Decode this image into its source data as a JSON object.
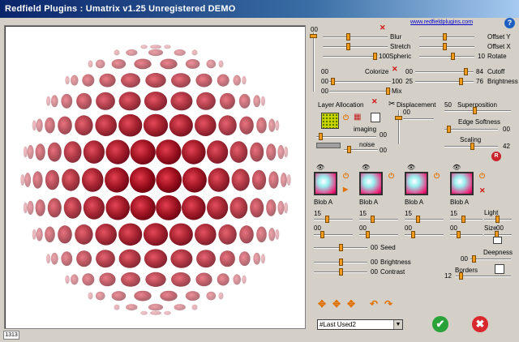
{
  "title": "Redfield Plugins : Umatrix v1.25     Unregistered  DEMO",
  "url": "www.redfieldplugins.com",
  "help_glyph": "?",
  "status": "1313",
  "sliders": {
    "left_vert_val": "00",
    "blur": {
      "label": "Blur"
    },
    "stretch": {
      "label": "Stretch"
    },
    "sphere": {
      "value": "100",
      "label": "Spheric"
    },
    "offset_y": {
      "label": "Offset Y"
    },
    "offset_x": {
      "label": "Offset X"
    },
    "rotate": {
      "value": "10",
      "label": "Rotate"
    },
    "colorize": {
      "label": "Colorize",
      "v1": "00",
      "v2": "00",
      "v3": "00",
      "v4": "100"
    },
    "mix": {
      "label": "Mix"
    },
    "cutoff": {
      "value": "84",
      "label": "Cutoff",
      "pre": "00"
    },
    "brightness_top": {
      "value": "76",
      "label": "Brightness",
      "pre": "25"
    }
  },
  "layer": {
    "label": "Layer Allocation",
    "imaging": "imaging",
    "noise": "noise",
    "v_imaging": "00",
    "v_noise": "00"
  },
  "displacement": {
    "label": "Displacement",
    "value": "00"
  },
  "superposition": {
    "label": "Superposition",
    "value": "50"
  },
  "edge_softness": {
    "label": "Edge Softness",
    "value": "00"
  },
  "scaling": {
    "label": "Scaling",
    "value": "42"
  },
  "reset_glyph": "R",
  "blobs": [
    {
      "label": "Blob A",
      "v1": "15",
      "v2": "00"
    },
    {
      "label": "Blob A",
      "v1": "15",
      "v2": "00"
    },
    {
      "label": "Blob A",
      "v1": "15",
      "v2": "00"
    },
    {
      "label": "Blob A",
      "v1": "15",
      "v2": "00"
    }
  ],
  "light": {
    "label": "Light"
  },
  "size": {
    "label": "Size",
    "value": "00"
  },
  "seed": {
    "label": "Seed",
    "value": "00"
  },
  "brightness": {
    "label": "Brightness",
    "value": "00"
  },
  "contrast": {
    "label": "Contrast",
    "value": "00"
  },
  "deepness": {
    "label": "Deepness",
    "value": "00"
  },
  "borders": {
    "label": "Borders",
    "value": "12"
  },
  "preset": {
    "selected": "#Last Used2"
  },
  "glyphs": {
    "ok": "✔",
    "cancel": "✖",
    "close_x": "✕",
    "power": "⏻",
    "eye": "👁",
    "arrow": "▶",
    "nav": "✥",
    "undo": "↶",
    "redo": "↷",
    "dropdown": "▼",
    "grid": "▦",
    "scissors": "✂"
  }
}
